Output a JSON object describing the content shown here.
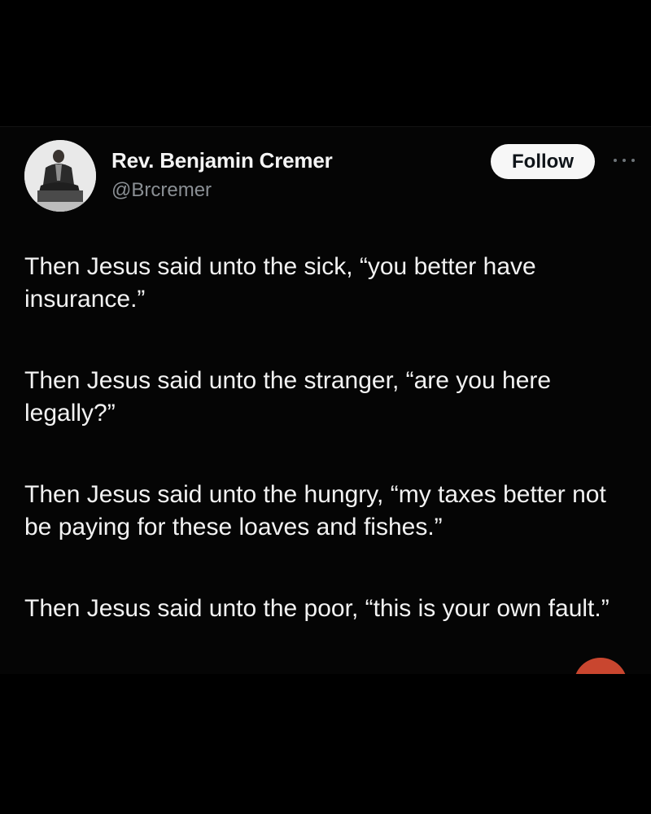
{
  "author": {
    "display_name": "Rev. Benjamin Cremer",
    "handle": "@Brcremer"
  },
  "actions": {
    "follow_label": "Follow",
    "more_icon": "more-horizontal-icon"
  },
  "tweet": {
    "paragraphs": [
      "Then Jesus said unto the sick, “you better have insurance.”",
      "Then Jesus said unto the stranger, “are you here legally?”",
      "Then Jesus said unto the hungry, “my taxes better not be paying for these loaves and fishes.”",
      "Then Jesus said unto the poor, “this is your own fault.”"
    ]
  },
  "colors": {
    "background": "#000000",
    "text": "#f2f2f2",
    "handle": "#8a8f94",
    "follow_bg": "#f7f7f7",
    "badge": "#c9462f"
  }
}
